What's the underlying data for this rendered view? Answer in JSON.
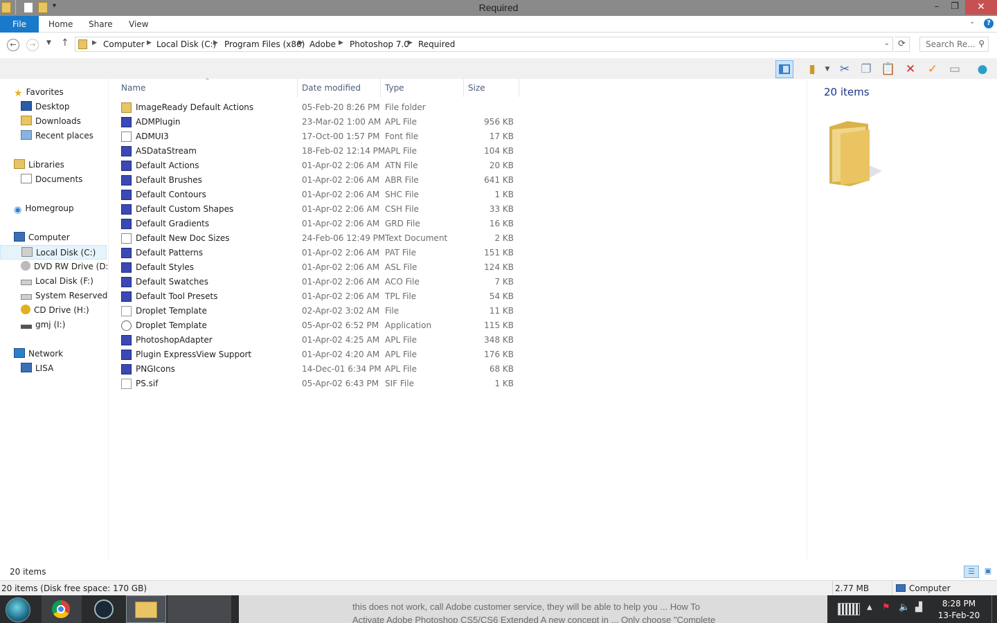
{
  "window": {
    "title": "Required",
    "minimize": "–",
    "restore": "❐",
    "close": "✕"
  },
  "ribbon": {
    "file": "File",
    "tabs": [
      "Home",
      "Share",
      "View"
    ],
    "help": "?"
  },
  "address": {
    "crumbs": [
      "Computer",
      "Local Disk (C:)",
      "Program Files (x86)",
      "Adobe",
      "Photoshop 7.0",
      "Required"
    ],
    "search_placeholder": "Search Re..."
  },
  "nav": {
    "favorites": {
      "label": "Favorites",
      "items": [
        "Desktop",
        "Downloads",
        "Recent places"
      ]
    },
    "libraries": {
      "label": "Libraries",
      "items": [
        "Documents"
      ]
    },
    "homegroup": "Homegroup",
    "computer": {
      "label": "Computer",
      "items": [
        "Local Disk (C:)",
        "DVD RW Drive (D:) N",
        "Local Disk (F:)",
        "System Reserved (G",
        "CD Drive (H:)",
        "gmj (I:)"
      ]
    },
    "network": {
      "label": "Network",
      "items": [
        "LISA"
      ]
    }
  },
  "columns": [
    "Name",
    "Date modified",
    "Type",
    "Size"
  ],
  "files": [
    {
      "name": "ImageReady Default Actions",
      "date": "05-Feb-20 8:26 PM",
      "type": "File folder",
      "size": "",
      "icon": "folder-icon"
    },
    {
      "name": "ADMPlugin",
      "date": "23-Mar-02 1:00 AM",
      "type": "APL File",
      "size": "956 KB",
      "icon": "plugin-icon"
    },
    {
      "name": "ADMUI3",
      "date": "17-Oct-00 1:57 PM",
      "type": "Font file",
      "size": "17 KB",
      "icon": "font-icon"
    },
    {
      "name": "ASDataStream",
      "date": "18-Feb-02 12:14 PM",
      "type": "APL File",
      "size": "104 KB",
      "icon": "plugin-icon"
    },
    {
      "name": "Default Actions",
      "date": "01-Apr-02 2:06 AM",
      "type": "ATN File",
      "size": "20 KB",
      "icon": "plugin-icon"
    },
    {
      "name": "Default Brushes",
      "date": "01-Apr-02 2:06 AM",
      "type": "ABR File",
      "size": "641 KB",
      "icon": "plugin-icon"
    },
    {
      "name": "Default Contours",
      "date": "01-Apr-02 2:06 AM",
      "type": "SHC File",
      "size": "1 KB",
      "icon": "plugin-icon"
    },
    {
      "name": "Default Custom Shapes",
      "date": "01-Apr-02 2:06 AM",
      "type": "CSH File",
      "size": "33 KB",
      "icon": "plugin-icon"
    },
    {
      "name": "Default Gradients",
      "date": "01-Apr-02 2:06 AM",
      "type": "GRD File",
      "size": "16 KB",
      "icon": "plugin-icon"
    },
    {
      "name": "Default New Doc Sizes",
      "date": "24-Feb-06 12:49 PM",
      "type": "Text Document",
      "size": "2 KB",
      "icon": "text-doc-icon"
    },
    {
      "name": "Default Patterns",
      "date": "01-Apr-02 2:06 AM",
      "type": "PAT File",
      "size": "151 KB",
      "icon": "plugin-icon"
    },
    {
      "name": "Default Styles",
      "date": "01-Apr-02 2:06 AM",
      "type": "ASL File",
      "size": "124 KB",
      "icon": "plugin-icon"
    },
    {
      "name": "Default Swatches",
      "date": "01-Apr-02 2:06 AM",
      "type": "ACO File",
      "size": "7 KB",
      "icon": "plugin-icon"
    },
    {
      "name": "Default Tool Presets",
      "date": "01-Apr-02 2:06 AM",
      "type": "TPL File",
      "size": "54 KB",
      "icon": "plugin-icon"
    },
    {
      "name": "Droplet Template",
      "date": "02-Apr-02 3:02 AM",
      "type": "File",
      "size": "11 KB",
      "icon": "blank-file-icon"
    },
    {
      "name": "Droplet Template",
      "date": "05-Apr-02 6:52 PM",
      "type": "Application",
      "size": "115 KB",
      "icon": "application-icon"
    },
    {
      "name": "PhotoshopAdapter",
      "date": "01-Apr-02 4:25 AM",
      "type": "APL File",
      "size": "348 KB",
      "icon": "plugin-icon"
    },
    {
      "name": "Plugin ExpressView Support",
      "date": "01-Apr-02 4:20 AM",
      "type": "APL File",
      "size": "176 KB",
      "icon": "plugin-icon"
    },
    {
      "name": "PNGIcons",
      "date": "14-Dec-01 6:34 PM",
      "type": "APL File",
      "size": "68 KB",
      "icon": "plugin-icon"
    },
    {
      "name": "PS.sif",
      "date": "05-Apr-02 6:43 PM",
      "type": "SIF File",
      "size": "1 KB",
      "icon": "blank-file-icon"
    }
  ],
  "preview": {
    "count": "20 items"
  },
  "status": {
    "items": "20 items",
    "detail": "20 items (Disk free space: 170 GB)",
    "size": "2.77 MB",
    "location": "Computer"
  },
  "taskbar": {
    "bg_lines": [
      "this does not work, call Adobe customer service, they will be able to help you ... How To",
      "Activate Adobe Photoshop CS5/CS6 Extended A new concept in ... Only choose \"Complete"
    ],
    "time": "8:28 PM",
    "date": "13-Feb-20"
  },
  "colors": {
    "accent": "#1979ca",
    "folder": "#e8c465",
    "plugin": "#3a49b5",
    "close": "#c75050"
  }
}
